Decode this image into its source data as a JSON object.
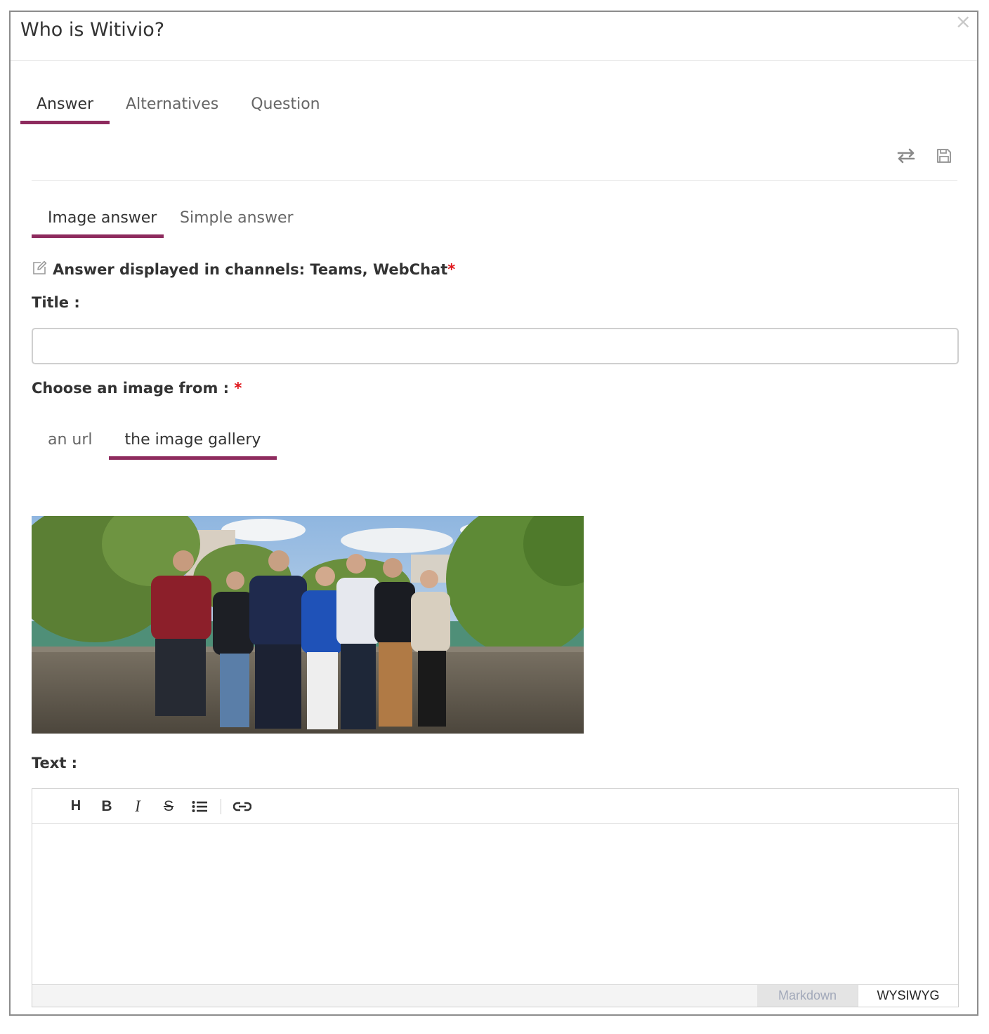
{
  "dialog": {
    "title": "Who is Witivio?",
    "close_glyph": "×"
  },
  "main_tabs": [
    {
      "label": "Answer",
      "active": true
    },
    {
      "label": "Alternatives",
      "active": false
    },
    {
      "label": "Question",
      "active": false
    }
  ],
  "toolbar": {
    "icons": [
      "swap-arrows-icon",
      "save-floppy-icon"
    ]
  },
  "sub_tabs": [
    {
      "label": "Image answer",
      "active": true
    },
    {
      "label": "Simple answer",
      "active": false
    }
  ],
  "channels": {
    "label": "Answer displayed in channels: Teams, WebChat",
    "required_mark": "*",
    "icon": "edit-icon"
  },
  "title_field": {
    "label": "Title :",
    "value": ""
  },
  "image_source": {
    "label": "Choose an image from :",
    "required_mark": "*",
    "tabs": [
      {
        "label": "an url",
        "active": false
      },
      {
        "label": "the image gallery",
        "active": true
      }
    ]
  },
  "text_field": {
    "label": "Text :",
    "toolbar_buttons": [
      "heading-icon",
      "bold-icon",
      "italic-icon",
      "strikethrough-icon",
      "bullet-list-icon",
      "link-icon"
    ],
    "modes": [
      {
        "label": "Markdown",
        "active": false
      },
      {
        "label": "WYSIWYG",
        "active": true
      }
    ]
  },
  "colors": {
    "accent": "#8e2b5e",
    "required": "#e0161b",
    "border": "#8c8c8c"
  }
}
